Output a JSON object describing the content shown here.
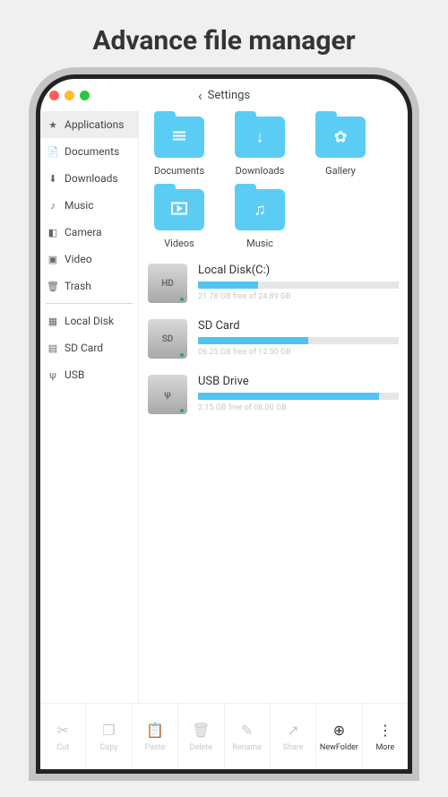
{
  "page": {
    "title": "Advance file manager"
  },
  "header": {
    "back": "Settings"
  },
  "sidebar": {
    "groups": [
      {
        "items": [
          {
            "label": "Applications",
            "icon": "★",
            "active": true
          },
          {
            "label": "Documents",
            "icon": "📄"
          },
          {
            "label": "Downloads",
            "icon": "⬇"
          },
          {
            "label": "Music",
            "icon": "♪"
          },
          {
            "label": "Camera",
            "icon": "◧"
          },
          {
            "label": "Video",
            "icon": "▣"
          },
          {
            "label": "Trash",
            "icon": "🗑"
          }
        ]
      },
      {
        "items": [
          {
            "label": "Local Disk",
            "icon": "▦"
          },
          {
            "label": "SD Card",
            "icon": "▤"
          },
          {
            "label": "USB",
            "icon": "ψ"
          }
        ]
      }
    ]
  },
  "folders": [
    {
      "label": "Documents",
      "name": "documents",
      "inner": "lines"
    },
    {
      "label": "Downloads",
      "name": "downloads",
      "inner": "↓"
    },
    {
      "label": "Gallery",
      "name": "gallery",
      "inner": "✿"
    },
    {
      "label": "Videos",
      "name": "videos",
      "inner": "▸"
    },
    {
      "label": "Music",
      "name": "music",
      "inner": "♫"
    }
  ],
  "storage": [
    {
      "name": "Local Disk(C:)",
      "badge": "HD",
      "sub": "21.78 GB free of 24.89 GB",
      "pct": 30
    },
    {
      "name": "SD Card",
      "badge": "SD",
      "sub": "06.25 GB free of 12.50 GB",
      "pct": 55
    },
    {
      "name": "USB Drive",
      "badge": "ψ",
      "sub": "2.15 GB free of 08.00 GB",
      "pct": 90
    }
  ],
  "bottombar": {
    "main": [
      {
        "label": "Cut",
        "icon": "✂"
      },
      {
        "label": "Copy",
        "icon": "❐"
      },
      {
        "label": "Paste",
        "icon": "📋"
      },
      {
        "label": "Delete",
        "icon": "🗑"
      },
      {
        "label": "Rename",
        "icon": "✎"
      },
      {
        "label": "Share",
        "icon": "↗"
      }
    ],
    "extra": [
      {
        "label": "NewFolder",
        "icon": "⊕"
      },
      {
        "label": "More",
        "icon": "⋮"
      }
    ]
  }
}
